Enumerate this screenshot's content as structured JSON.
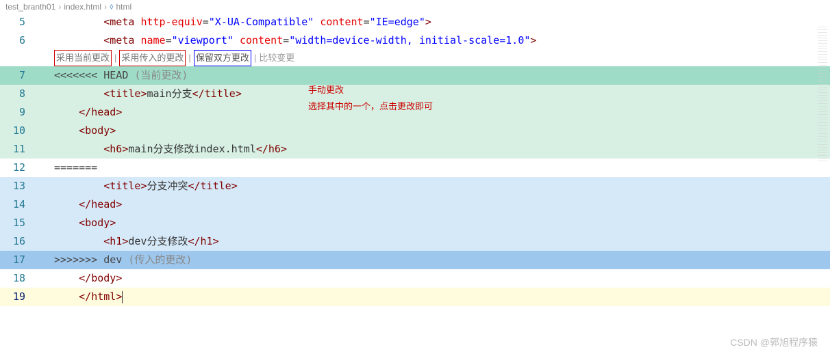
{
  "breadcrumb": {
    "folder": "test_branth01",
    "file": "index.html",
    "symbol": "html"
  },
  "codelens": {
    "accept_current": "采用当前更改",
    "accept_incoming": "采用传入的更改",
    "accept_both": "保留双方更改",
    "compare": "比较变更"
  },
  "annotations": {
    "manual": "手动更改",
    "choose": "选择其中的一个，点击更改即可"
  },
  "conflict": {
    "head_marker": "<<<<<<< HEAD",
    "head_label": "(当前更改)",
    "sep_marker": "=======",
    "tail_marker": ">>>>>>> dev",
    "tail_label": "(传入的更改)"
  },
  "lines": {
    "l5": {
      "indent": "        ",
      "open": "<meta",
      "attr1": "http-equiv",
      "val1": "\"X-UA-Compatible\"",
      "attr2": "content",
      "val2": "\"IE=edge\"",
      "close": ">"
    },
    "l6": {
      "indent": "        ",
      "open": "<meta",
      "attr1": "name",
      "val1": "\"viewport\"",
      "attr2": "content",
      "val2": "\"width=device-width, initial-scale=1.0\"",
      "close": ">"
    },
    "l8": {
      "indent": "        ",
      "open": "<title>",
      "text": "main分支",
      "close": "</title>"
    },
    "l9": {
      "indent": "    ",
      "text": "</head>"
    },
    "l10": {
      "indent": "    ",
      "text": "<body>"
    },
    "l11": {
      "indent": "        ",
      "open": "<h6>",
      "text": "main分支修改index.html",
      "close": "</h6>"
    },
    "l13": {
      "indent": "        ",
      "open": "<title>",
      "text": "分支冲突",
      "close": "</title>"
    },
    "l14": {
      "indent": "    ",
      "text": "</head>"
    },
    "l15": {
      "indent": "    ",
      "text": "<body>"
    },
    "l16": {
      "indent": "        ",
      "open": "<h1>",
      "text": "dev分支修改",
      "close": "</h1>"
    },
    "l18": {
      "indent": "    ",
      "text": "</body>"
    },
    "l19": {
      "indent": "    ",
      "text": "</html>"
    }
  },
  "gutter": [
    "5",
    "6",
    "7",
    "8",
    "9",
    "10",
    "11",
    "12",
    "13",
    "14",
    "15",
    "16",
    "17",
    "18",
    "19"
  ],
  "watermark": "CSDN @郭旭程序猿"
}
